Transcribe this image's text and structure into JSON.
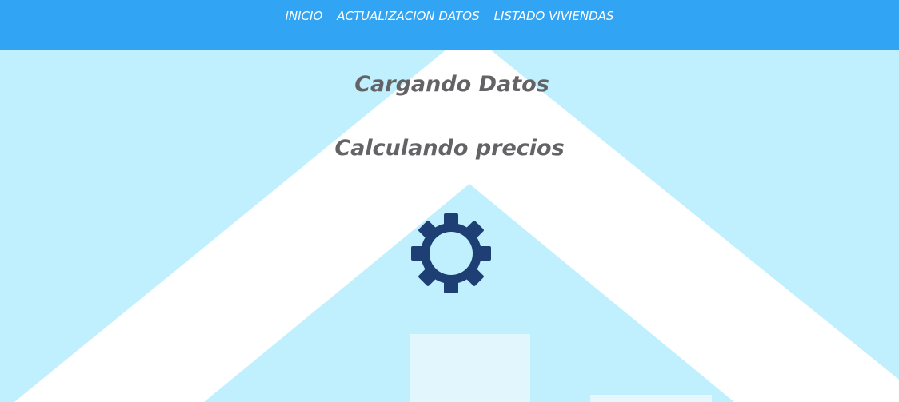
{
  "nav": {
    "items": [
      {
        "label": "INICIO"
      },
      {
        "label": "ACTUALIZACION DATOS"
      },
      {
        "label": "LISTADO VIVIENDAS"
      }
    ]
  },
  "status": {
    "loading_title": "Cargando Datos",
    "calculating_title": "Calculando precios"
  },
  "icons": {
    "spinner": "gear-icon"
  },
  "colors": {
    "nav_background": "#31a4f4",
    "page_background": "#c0f0fe",
    "heading_text": "#636366",
    "gear": "#1d3f74"
  }
}
